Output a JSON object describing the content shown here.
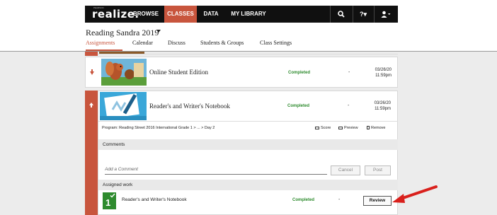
{
  "nav": {
    "logo": "realize.",
    "logo_small": "PEARSON",
    "items": [
      {
        "label": "BROWSE"
      },
      {
        "label": "CLASSES"
      },
      {
        "label": "DATA"
      },
      {
        "label": "MY LIBRARY"
      }
    ],
    "search_icon": "🔍",
    "help_icon": "?▾",
    "user_icon": "👤▾"
  },
  "class": {
    "title": "Reading Sandra 2019",
    "tabs": [
      "Assignments",
      "Calendar",
      "Discuss",
      "Students & Groups",
      "Class Settings"
    ]
  },
  "assignments": [
    {
      "title": "Online Student Edition",
      "status": "Completed",
      "score": "-",
      "date": "03/26/20",
      "time": "11:59pm",
      "thumb_icon": "squirrel-thumbnail-icon"
    },
    {
      "title": "Reader's and Writer's Notebook",
      "status": "Completed",
      "score": "-",
      "date": "03/26/20",
      "time": "11:59pm",
      "thumb_icon": "notebook-thumbnail-icon"
    }
  ],
  "detail": {
    "program": "Program: Reading Street 2016 International Grade 1 > ... > Day 2",
    "actions": [
      "Score",
      "Preview",
      "Remove"
    ],
    "comments_label": "Comments",
    "comment_placeholder": "Add a Comment",
    "cancel_label": "Cancel",
    "post_label": "Post",
    "assigned_work_label": "Assigned work",
    "work": {
      "badge": "1",
      "title": "Reader's and Writer's Notebook",
      "status": "Completed",
      "score": "-",
      "review_label": "Review"
    }
  },
  "colors": {
    "accent": "#c8553d",
    "completed": "#2e8b2e",
    "annotation_arrow": "#d9201c"
  }
}
